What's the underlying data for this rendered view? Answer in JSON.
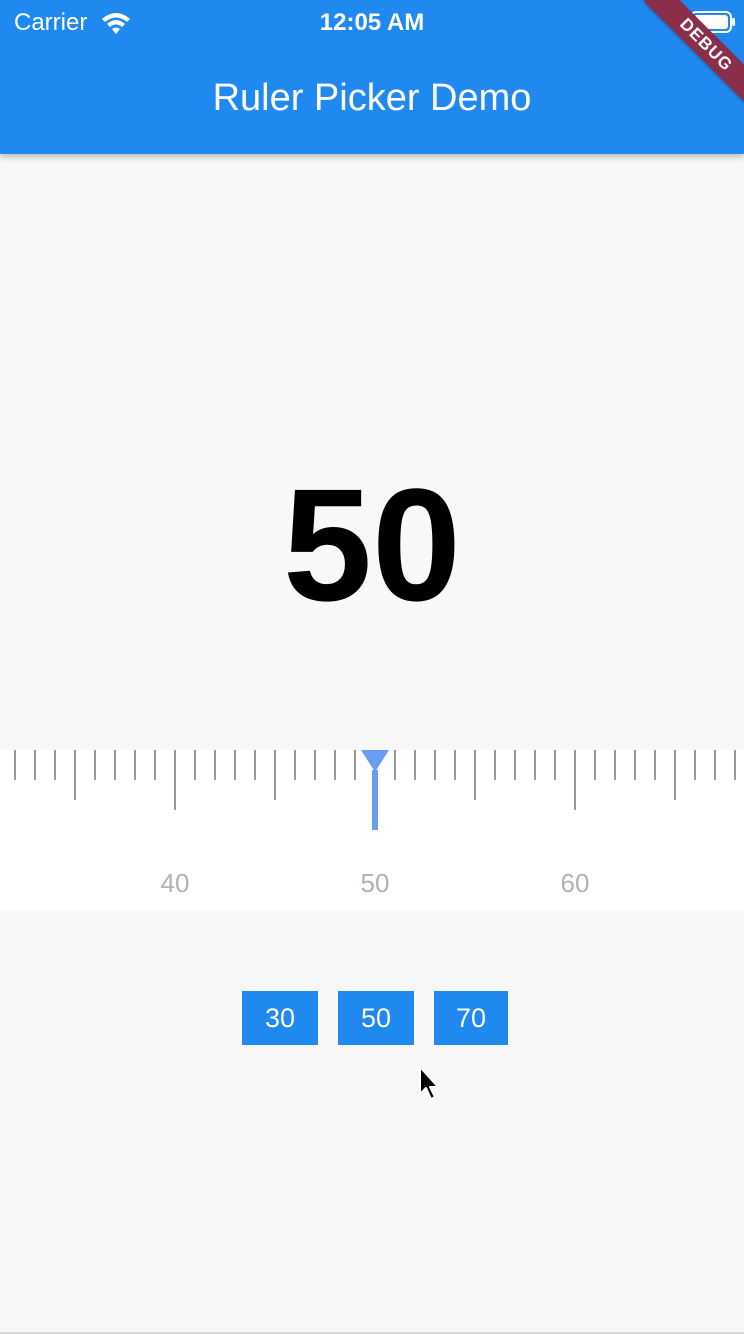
{
  "status_bar": {
    "carrier": "Carrier",
    "time": "12:05 AM",
    "wifi_icon": "wifi-icon",
    "battery_icon": "battery-icon"
  },
  "app_bar": {
    "title": "Ruler Picker Demo",
    "color": "#2089f0"
  },
  "debug_banner": {
    "label": "DEBUG",
    "color": "#8a2e4a"
  },
  "display": {
    "value": "50"
  },
  "ruler": {
    "min": 30,
    "max": 70,
    "current": 50,
    "labels": [
      "40",
      "50",
      "60"
    ],
    "indicator_color": "#6b9cf2"
  },
  "preset_buttons": [
    {
      "label": "30"
    },
    {
      "label": "50"
    },
    {
      "label": "70"
    }
  ]
}
